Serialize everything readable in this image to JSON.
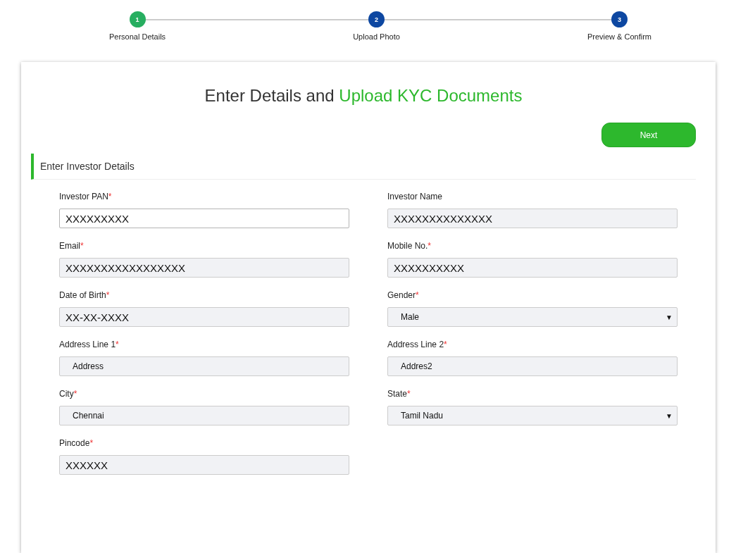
{
  "steps": [
    {
      "number": "1",
      "label": "Personal Details",
      "done": true
    },
    {
      "number": "2",
      "label": "Upload Photo",
      "done": false
    },
    {
      "number": "3",
      "label": "Preview & Confirm",
      "done": false
    }
  ],
  "heading": {
    "text": "Enter Details and",
    "highlight": "Upload KYC Documents"
  },
  "next_button": "Next",
  "section_title": "Enter Investor Details",
  "fields": [
    {
      "label": "Investor PAN",
      "required_mark": "*",
      "kind": "masked",
      "value": "XXXXXXXXX",
      "readonly": false
    },
    {
      "label": "Investor Name",
      "kind": "masked",
      "value": "XXXXXXXXXXXXXX",
      "readonly": true
    },
    {
      "label": "Email",
      "required_mark": "*",
      "kind": "masked",
      "value": "XXXXXXXXXXXXXXXXX",
      "readonly": true
    },
    {
      "label": "Mobile No.",
      "required_mark": "*",
      "kind": "masked",
      "value": "XXXXXXXXXX",
      "readonly": true
    },
    {
      "label": "Date of Birth",
      "required_mark": "*",
      "kind": "masked",
      "value": "XX-XX-XXXX",
      "readonly": true
    },
    {
      "label": "Gender",
      "required_mark": "*",
      "kind": "select",
      "value": "Male",
      "caret": "▼",
      "readonly": true
    },
    {
      "label": "Address Line 1",
      "required_mark": "*",
      "kind": "text",
      "value": "Address",
      "readonly": true
    },
    {
      "label": "Address Line 2",
      "required_mark": "*",
      "kind": "text",
      "value": "Addres2",
      "readonly": true
    },
    {
      "label": "City",
      "required_mark": "*",
      "kind": "text",
      "value": "Chennai",
      "readonly": true
    },
    {
      "label": "State",
      "required_mark": "*",
      "kind": "select",
      "value": "Tamil Nadu",
      "caret": "▼",
      "readonly": true
    },
    {
      "label": "Pincode",
      "required_mark": "*",
      "kind": "masked",
      "value": "XXXXXX",
      "readonly": true
    }
  ]
}
